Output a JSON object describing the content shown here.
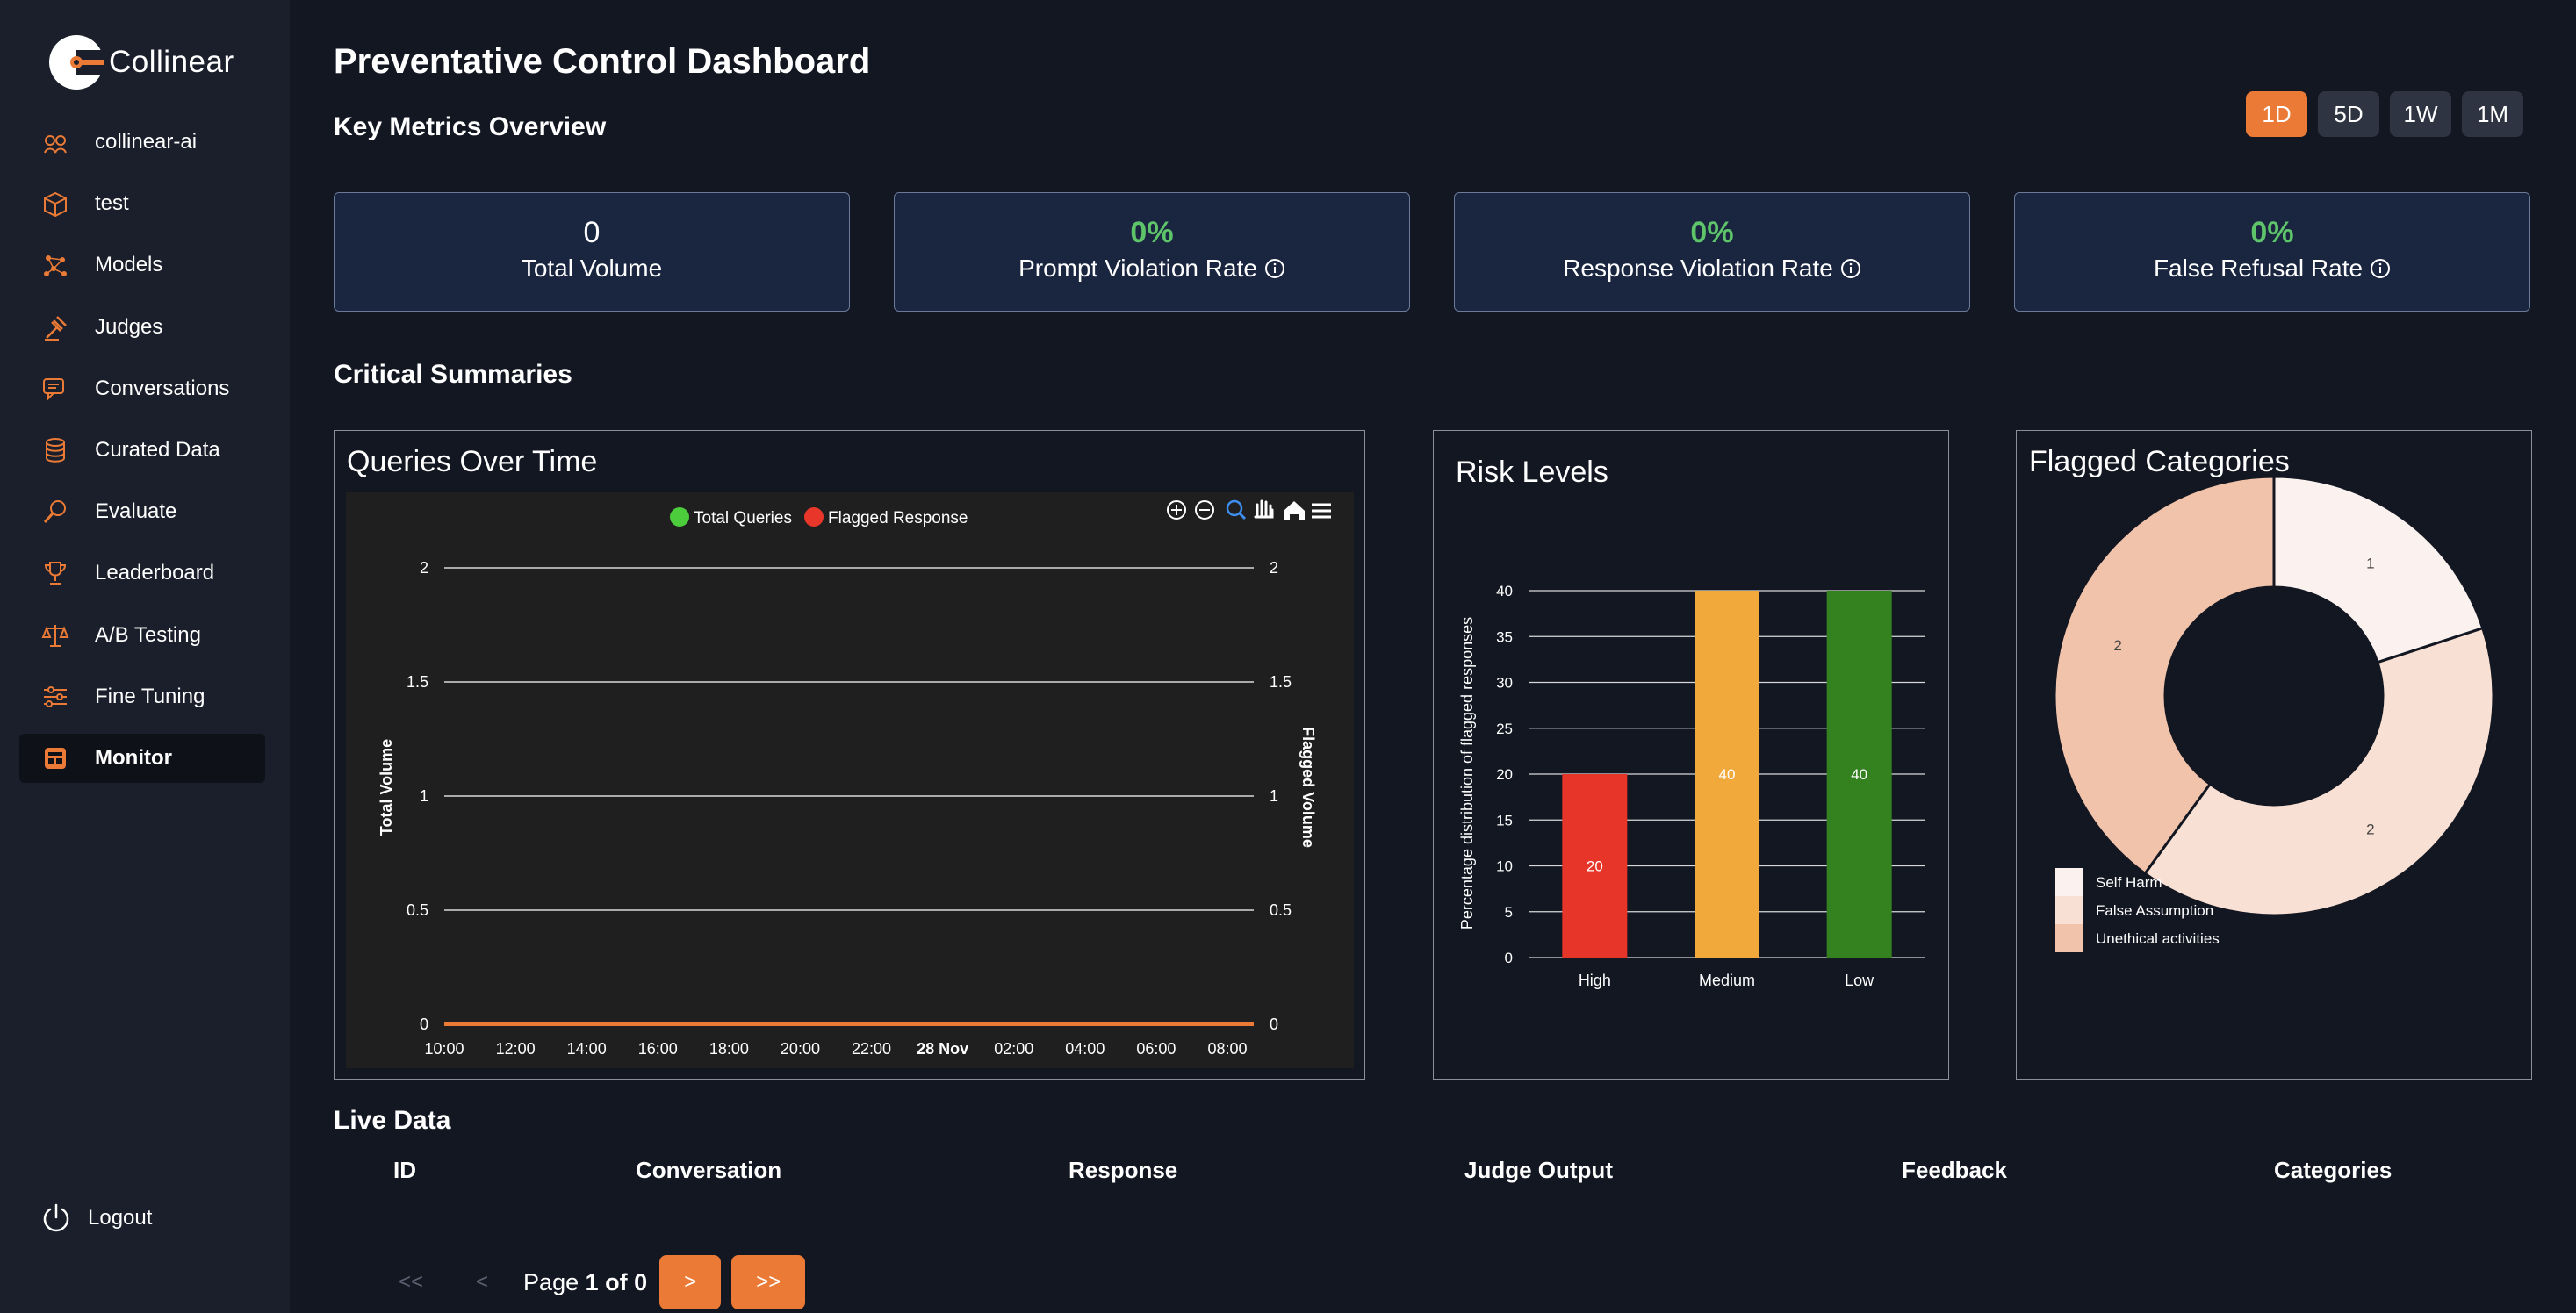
{
  "brand": {
    "name": "Collinear"
  },
  "sidebar": {
    "items": [
      {
        "label": "collinear-ai",
        "icon": "team-icon"
      },
      {
        "label": "test",
        "icon": "cube-icon"
      },
      {
        "label": "Models",
        "icon": "network-icon"
      },
      {
        "label": "Judges",
        "icon": "gavel-icon"
      },
      {
        "label": "Conversations",
        "icon": "chat-icon"
      },
      {
        "label": "Curated Data",
        "icon": "database-icon"
      },
      {
        "label": "Evaluate",
        "icon": "magnifier-icon"
      },
      {
        "label": "Leaderboard",
        "icon": "trophy-icon"
      },
      {
        "label": "A/B Testing",
        "icon": "scale-icon"
      },
      {
        "label": "Fine Tuning",
        "icon": "sliders-icon"
      },
      {
        "label": "Monitor",
        "icon": "monitor-icon",
        "active": true
      }
    ],
    "logout": "Logout"
  },
  "header": {
    "title": "Preventative Control Dashboard",
    "key_metrics_title": "Key Metrics Overview",
    "ranges": [
      "1D",
      "5D",
      "1W",
      "1M"
    ],
    "active_range": "1D"
  },
  "metrics": [
    {
      "value": "0",
      "label": "Total Volume"
    },
    {
      "value": "0%",
      "label": "Prompt Violation Rate"
    },
    {
      "value": "0%",
      "label": "Response Violation Rate"
    },
    {
      "value": "0%",
      "label": "False Refusal Rate"
    }
  ],
  "critical_summaries_title": "Critical Summaries",
  "chart_data": [
    {
      "type": "line",
      "title": "Queries Over Time",
      "legend": [
        "Total Queries",
        "Flagged Response"
      ],
      "legend_colors": [
        "#4ccd3c",
        "#e8362a"
      ],
      "x": [
        "10:00",
        "12:00",
        "14:00",
        "16:00",
        "18:00",
        "20:00",
        "22:00",
        "28 Nov",
        "02:00",
        "04:00",
        "06:00",
        "08:00"
      ],
      "ylabel": "Total Volume",
      "y2label": "Flagged Volume",
      "ylim": [
        0,
        2
      ],
      "yticks": [
        "0",
        "0.5",
        "1",
        "1.5",
        "2"
      ],
      "series": [
        {
          "name": "Total Queries",
          "values": [
            0,
            0,
            0,
            0,
            0,
            0,
            0,
            0,
            0,
            0,
            0,
            0
          ]
        },
        {
          "name": "Flagged Response",
          "values": [
            0,
            0,
            0,
            0,
            0,
            0,
            0,
            0,
            0,
            0,
            0,
            0
          ]
        }
      ],
      "background": "#1f1f1f"
    },
    {
      "type": "bar",
      "title": "Risk Levels",
      "categories": [
        "High",
        "Medium",
        "Low"
      ],
      "values": [
        20,
        40,
        40
      ],
      "colors": [
        "#e8352a",
        "#f2a93b",
        "#33821f"
      ],
      "ylabel": "Percentage distribution of flagged responses",
      "ylim": [
        0,
        40
      ],
      "yticks": [
        "0",
        "5",
        "10",
        "15",
        "20",
        "25",
        "30",
        "35",
        "40"
      ]
    },
    {
      "type": "pie",
      "title": "Flagged Categories",
      "labels": [
        "Self Harm",
        "False Assumption",
        "Unethical activities"
      ],
      "values": [
        1,
        2,
        2
      ],
      "colors": [
        "#fbf2ef",
        "#f9e0d4",
        "#f2c3ab"
      ],
      "hole": true
    }
  ],
  "live_data": {
    "title": "Live Data",
    "columns": [
      "ID",
      "Conversation",
      "Response",
      "Judge Output",
      "Feedback",
      "Categories"
    ]
  },
  "pager": {
    "first": "<<",
    "prev": "<",
    "page_label": "Page",
    "current": "1",
    "of_label": "of",
    "total": "0",
    "next": ">",
    "last": ">>"
  }
}
